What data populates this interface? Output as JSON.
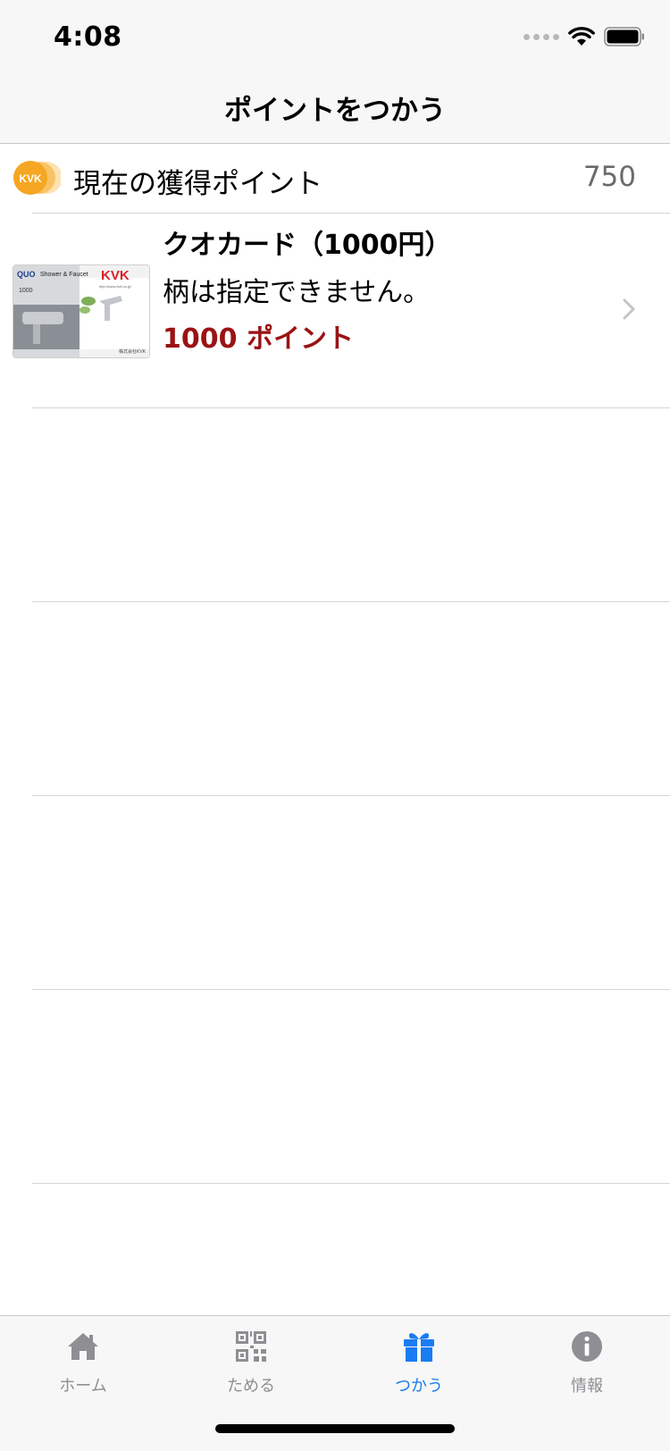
{
  "status_bar": {
    "time": "4:08",
    "icons": [
      "signal-dots-icon",
      "wifi-icon",
      "battery-icon"
    ]
  },
  "nav": {
    "title": "ポイントをつかう"
  },
  "points": {
    "logo_text": "KVK",
    "label": "現在の獲得ポイント",
    "value": "750"
  },
  "rewards": [
    {
      "name": "クオカード（1000円）",
      "description": "柄は指定できません。",
      "points": "1000 ポイント",
      "image": {
        "brand_quo": "QUO",
        "value": "1000",
        "caption": "Shower & Faucet",
        "brand": "KVK",
        "url": "http://www.kvk.co.jp/",
        "footer": "株式会社KVK"
      }
    }
  ],
  "tabs": [
    {
      "label": "ホーム",
      "icon": "home-icon",
      "active": false
    },
    {
      "label": "ためる",
      "icon": "qr-code-icon",
      "active": false
    },
    {
      "label": "つかう",
      "icon": "gift-icon",
      "active": true
    },
    {
      "label": "情報",
      "icon": "info-icon",
      "active": false
    }
  ],
  "colors": {
    "accent": "#1a7cf2",
    "points_red": "#9b1214",
    "logo_orange": "#f5a623"
  }
}
